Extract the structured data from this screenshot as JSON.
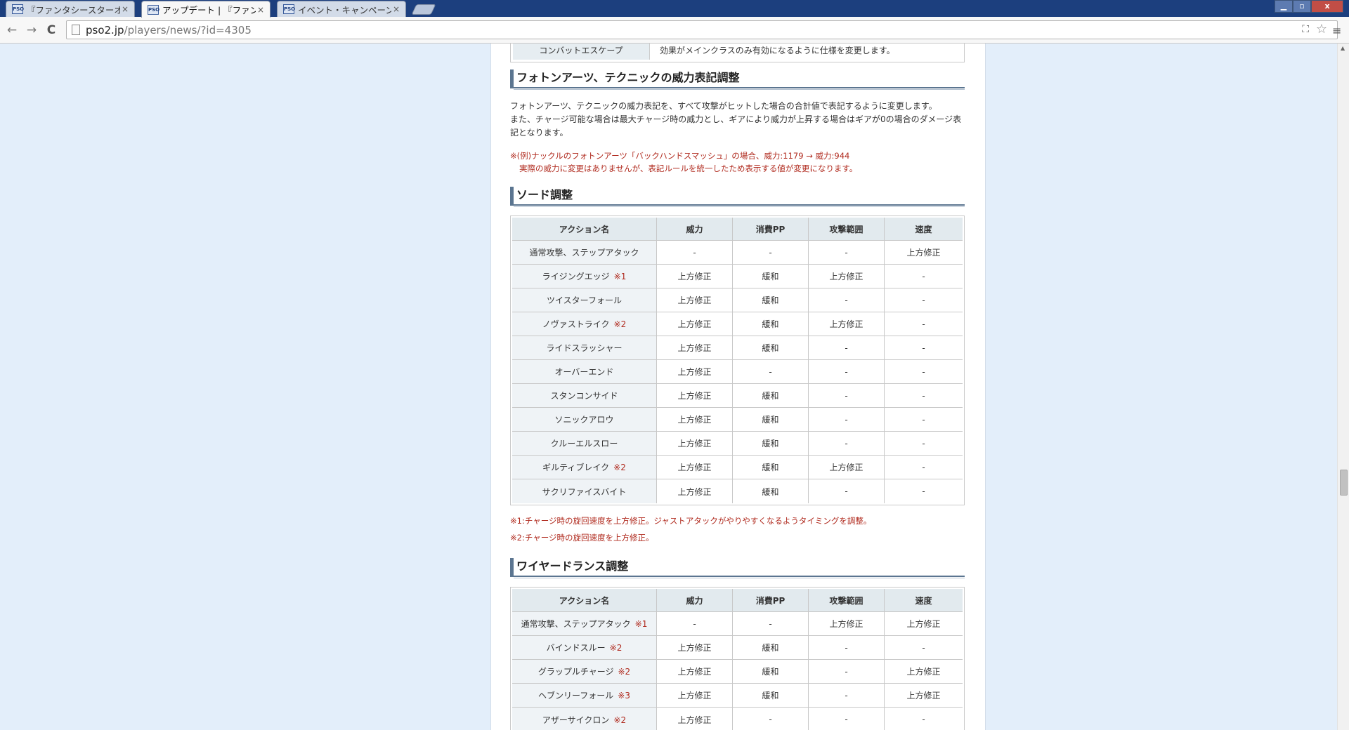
{
  "browser": {
    "tabs": [
      {
        "title": "『ファンタシースターオ"
      },
      {
        "title": "アップデート | 『ファンタ"
      },
      {
        "title": "イベント・キャンペーン"
      }
    ],
    "favicon_text": "PSO",
    "close_glyph": "×",
    "url_host": "pso2.jp",
    "url_path": "/players/news/?id=4305",
    "back_glyph": "←",
    "forward_glyph": "→",
    "reload_glyph": "C",
    "star_glyph": "☆",
    "menu_glyph": "≡",
    "translate_glyph": "⛶",
    "min_glyph": "▁",
    "max_glyph": "▫",
    "winclose_glyph": "x",
    "scroll_up_glyph": "▲"
  },
  "page": {
    "prev_table_tail": {
      "name": "コンバットエスケープ",
      "desc": "効果がメインクラスのみ有効になるように仕様を変更します。"
    },
    "section1": {
      "heading": "フォトンアーツ、テクニックの威力表記調整",
      "para1": "フォトンアーツ、テクニックの威力表記を、すべて攻撃がヒットした場合の合計値で表記するように変更します。",
      "para2": "また、チャージ可能な場合は最大チャージ時の威力とし、ギアにより威力が上昇する場合はギアが0の場合のダメージ表記となります。",
      "note1": "※(例)ナックルのフォトンアーツ「バックハンドスマッシュ」の場合、威力:1179 → 威力:944",
      "note2": "実際の威力に変更はありませんが、表記ルールを統一したため表示する値が変更になります。"
    },
    "sword": {
      "heading": "ソード調整",
      "columns": [
        "アクション名",
        "威力",
        "消費PP",
        "攻撃範囲",
        "速度"
      ],
      "rows": [
        {
          "name": "通常攻撃、ステップアタック",
          "mark": "",
          "power": "-",
          "pp": "-",
          "range": "-",
          "speed": "上方修正"
        },
        {
          "name": "ライジングエッジ",
          "mark": "※1",
          "power": "上方修正",
          "pp": "緩和",
          "range": "上方修正",
          "speed": "-"
        },
        {
          "name": "ツイスターフォール",
          "mark": "",
          "power": "上方修正",
          "pp": "緩和",
          "range": "-",
          "speed": "-"
        },
        {
          "name": "ノヴァストライク",
          "mark": "※2",
          "power": "上方修正",
          "pp": "緩和",
          "range": "上方修正",
          "speed": "-"
        },
        {
          "name": "ライドスラッシャー",
          "mark": "",
          "power": "上方修正",
          "pp": "緩和",
          "range": "-",
          "speed": "-"
        },
        {
          "name": "オーバーエンド",
          "mark": "",
          "power": "上方修正",
          "pp": "-",
          "range": "-",
          "speed": "-"
        },
        {
          "name": "スタンコンサイド",
          "mark": "",
          "power": "上方修正",
          "pp": "緩和",
          "range": "-",
          "speed": "-"
        },
        {
          "name": "ソニックアロウ",
          "mark": "",
          "power": "上方修正",
          "pp": "緩和",
          "range": "-",
          "speed": "-"
        },
        {
          "name": "クルーエルスロー",
          "mark": "",
          "power": "上方修正",
          "pp": "緩和",
          "range": "-",
          "speed": "-"
        },
        {
          "name": "ギルティブレイク",
          "mark": "※2",
          "power": "上方修正",
          "pp": "緩和",
          "range": "上方修正",
          "speed": "-"
        },
        {
          "name": "サクリファイスバイト",
          "mark": "",
          "power": "上方修正",
          "pp": "緩和",
          "range": "-",
          "speed": "-"
        }
      ],
      "footnote1": "※1:チャージ時の旋回速度を上方修正。ジャストアタックがやりやすくなるようタイミングを調整。",
      "footnote2": "※2:チャージ時の旋回速度を上方修正。"
    },
    "wirelance": {
      "heading": "ワイヤードランス調整",
      "columns": [
        "アクション名",
        "威力",
        "消費PP",
        "攻撃範囲",
        "速度"
      ],
      "rows": [
        {
          "name": "通常攻撃、ステップアタック",
          "mark": "※1",
          "power": "-",
          "pp": "-",
          "range": "上方修正",
          "speed": "上方修正"
        },
        {
          "name": "バインドスルー",
          "mark": "※2",
          "power": "上方修正",
          "pp": "緩和",
          "range": "-",
          "speed": "-"
        },
        {
          "name": "グラップルチャージ",
          "mark": "※2",
          "power": "上方修正",
          "pp": "緩和",
          "range": "-",
          "speed": "上方修正"
        },
        {
          "name": "ヘブンリーフォール",
          "mark": "※3",
          "power": "上方修正",
          "pp": "緩和",
          "range": "-",
          "speed": "上方修正"
        },
        {
          "name": "アザーサイクロン",
          "mark": "※2",
          "power": "上方修正",
          "pp": "-",
          "range": "-",
          "speed": "-"
        }
      ]
    }
  }
}
